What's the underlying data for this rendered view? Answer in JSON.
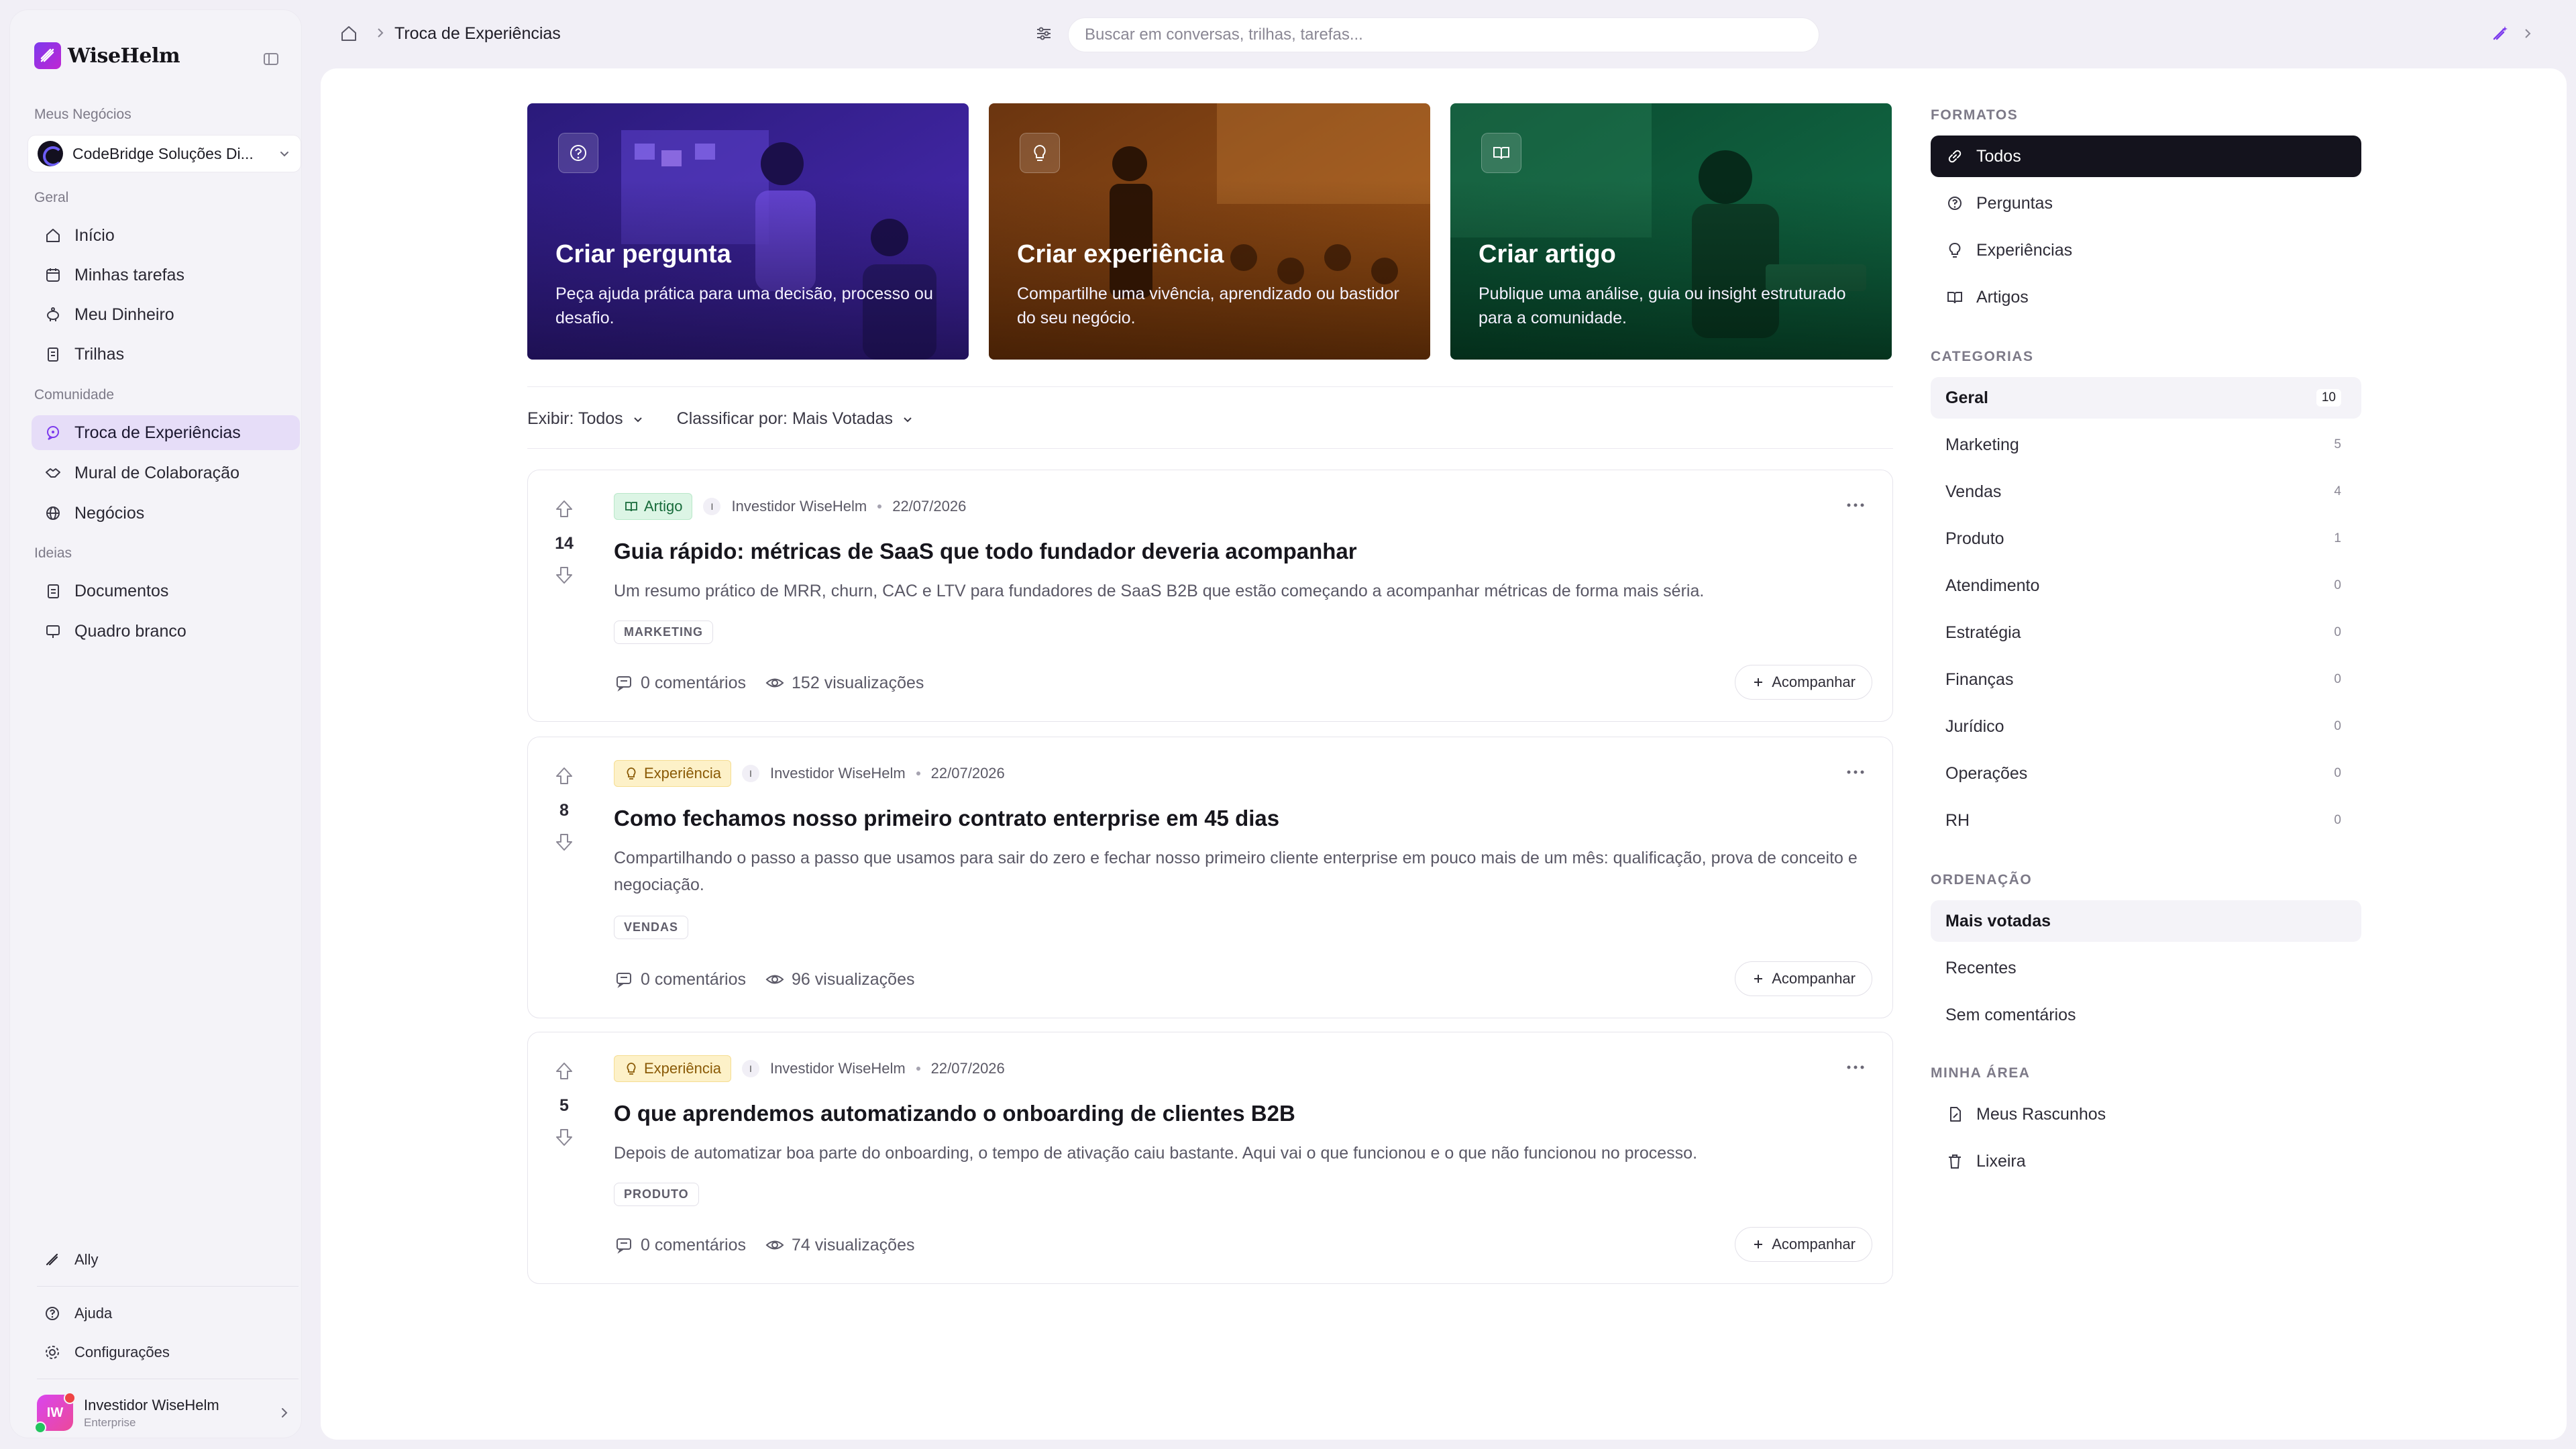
{
  "app": {
    "name": "WiseHelm"
  },
  "sidebar": {
    "my_business_label": "Meus Negócios",
    "business_name": "CodeBridge Soluções Di...",
    "sections": {
      "general": "Geral",
      "community": "Comunidade",
      "ideas": "Ideias"
    },
    "items": [
      {
        "label": "Início",
        "icon": "home-icon"
      },
      {
        "label": "Minhas tarefas",
        "icon": "calendar-icon"
      },
      {
        "label": "Meu Dinheiro",
        "icon": "piggy-bank-icon"
      },
      {
        "label": "Trilhas",
        "icon": "clipboard-icon"
      },
      {
        "label": "Troca de Experiências",
        "icon": "chat-icon"
      },
      {
        "label": "Mural de Colaboração",
        "icon": "handshake-icon"
      },
      {
        "label": "Negócios",
        "icon": "globe-icon"
      },
      {
        "label": "Documentos",
        "icon": "document-icon"
      },
      {
        "label": "Quadro branco",
        "icon": "whiteboard-icon"
      }
    ],
    "bottom": {
      "ally": "Ally",
      "help": "Ajuda",
      "settings": "Configurações"
    },
    "user": {
      "initials": "IW",
      "name": "Investidor WiseHelm",
      "plan": "Enterprise"
    }
  },
  "topbar": {
    "breadcrumb": "Troca de Experiências",
    "search_placeholder": "Buscar em conversas, trilhas, tarefas..."
  },
  "hero": [
    {
      "title": "Criar pergunta",
      "desc": "Peça ajuda prática para uma decisão, processo ou desafio.",
      "icon": "question-icon",
      "color": "#3b1f8f"
    },
    {
      "title": "Criar experiência",
      "desc": "Compartilhe uma vivência, aprendizado ou bastidor do seu negócio.",
      "icon": "lightbulb-icon",
      "color": "#8a4412"
    },
    {
      "title": "Criar artigo",
      "desc": "Publique uma análise, guia ou insight estruturado para a comunidade.",
      "icon": "book-icon",
      "color": "#0f5a3a"
    }
  ],
  "feed": {
    "show_label": "Exibir: Todos",
    "sort_label": "Classificar por: Mais Votadas",
    "posts": [
      {
        "votes": "14",
        "type": "Artigo",
        "author_initial": "I",
        "author": "Investidor WiseHelm",
        "date": "22/07/2026",
        "title": "Guia rápido: métricas de SaaS que todo fundador deveria acompanhar",
        "excerpt": "Um resumo prático de MRR, churn, CAC e LTV para fundadores de SaaS B2B que estão começando a acompanhar métricas de forma mais séria.",
        "tag": "MARKETING",
        "comments": "0 comentários",
        "views": "152 visualizações",
        "follow": "Acompanhar"
      },
      {
        "votes": "8",
        "type": "Experiência",
        "author_initial": "I",
        "author": "Investidor WiseHelm",
        "date": "22/07/2026",
        "title": "Como fechamos nosso primeiro contrato enterprise em 45 dias",
        "excerpt": "Compartilhando o passo a passo que usamos para sair do zero e fechar nosso primeiro cliente enterprise em pouco mais de um mês: qualificação, prova de conceito e negociação.",
        "tag": "VENDAS",
        "comments": "0 comentários",
        "views": "96 visualizações",
        "follow": "Acompanhar"
      },
      {
        "votes": "5",
        "type": "Experiência",
        "author_initial": "I",
        "author": "Investidor WiseHelm",
        "date": "22/07/2026",
        "title": "O que aprendemos automatizando o onboarding de clientes B2B",
        "excerpt": "Depois de automatizar boa parte do onboarding, o tempo de ativação caiu bastante. Aqui vai o que funcionou e o que não funcionou no processo.",
        "tag": "PRODUTO",
        "comments": "0 comentários",
        "views": "74 visualizações",
        "follow": "Acompanhar"
      }
    ]
  },
  "rail": {
    "formats_label": "FORMATOS",
    "formats": [
      {
        "label": "Todos",
        "icon": "link-icon"
      },
      {
        "label": "Perguntas",
        "icon": "question-icon"
      },
      {
        "label": "Experiências",
        "icon": "lightbulb-icon"
      },
      {
        "label": "Artigos",
        "icon": "book-icon"
      }
    ],
    "categories_label": "CATEGORIAS",
    "categories": [
      {
        "label": "Geral",
        "count": "10"
      },
      {
        "label": "Marketing",
        "count": "5"
      },
      {
        "label": "Vendas",
        "count": "4"
      },
      {
        "label": "Produto",
        "count": "1"
      },
      {
        "label": "Atendimento",
        "count": "0"
      },
      {
        "label": "Estratégia",
        "count": "0"
      },
      {
        "label": "Finanças",
        "count": "0"
      },
      {
        "label": "Jurídico",
        "count": "0"
      },
      {
        "label": "Operações",
        "count": "0"
      },
      {
        "label": "RH",
        "count": "0"
      }
    ],
    "sort_label": "ORDENAÇÃO",
    "sorts": [
      {
        "label": "Mais votadas"
      },
      {
        "label": "Recentes"
      },
      {
        "label": "Sem comentários"
      }
    ],
    "my_area_label": "MINHA ÁREA",
    "my_area": [
      {
        "label": "Meus Rascunhos",
        "icon": "draft-icon"
      },
      {
        "label": "Lixeira",
        "icon": "trash-icon"
      }
    ]
  }
}
